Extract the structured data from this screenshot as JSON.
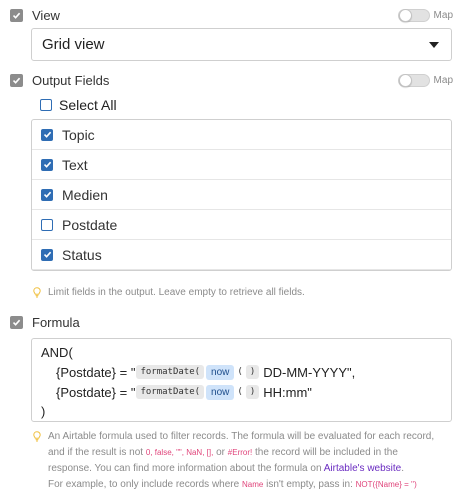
{
  "view": {
    "title": "View",
    "map_label": "Map",
    "selected": "Grid view"
  },
  "output_fields": {
    "title": "Output Fields",
    "map_label": "Map",
    "select_all_label": "Select All",
    "fields": [
      {
        "label": "Topic",
        "checked": true
      },
      {
        "label": "Text",
        "checked": true
      },
      {
        "label": "Medien",
        "checked": true
      },
      {
        "label": "Postdate",
        "checked": false
      },
      {
        "label": "Status",
        "checked": true
      }
    ],
    "hint": "Limit fields in the output. Leave empty to retrieve all fields."
  },
  "formula": {
    "title": "Formula",
    "line1": "AND(",
    "line2_pre": "{Postdate} = \"",
    "line2_fn": "formatDate(",
    "line2_now": "now",
    "line2_open": "(",
    "line2_close": ")",
    "line2_post": "DD-MM-YYYY\",",
    "line3_pre": "{Postdate} = \"",
    "line3_fn": "formatDate(",
    "line3_now": "now",
    "line3_open": "(",
    "line3_close": ")",
    "line3_post": "HH:mm\"",
    "line4": ")",
    "hint_l1": "An Airtable formula used to filter records. The formula will be evaluated for each record,",
    "hint_l2_a": "and if the result is not ",
    "hint_l2_codes": "0, false, \"\", NaN, [],",
    "hint_l2_or": " or ",
    "hint_l2_err": "#Error!",
    "hint_l2_b": " the record will be included in the",
    "hint_l3_a": "response. You can find more information about the formula on ",
    "hint_l3_link": "Airtable's website",
    "hint_l3_b": ".",
    "hint_l4_a": "For example, to only include records where ",
    "hint_l4_name": "Name",
    "hint_l4_b": " isn't empty, pass in: ",
    "hint_l4_code": "NOT({Name} = '')"
  },
  "colors": {
    "accent": "#2f6db4",
    "section_check": "#8c8c8c",
    "code_red": "#e0457b",
    "link": "#6a2bc1"
  }
}
